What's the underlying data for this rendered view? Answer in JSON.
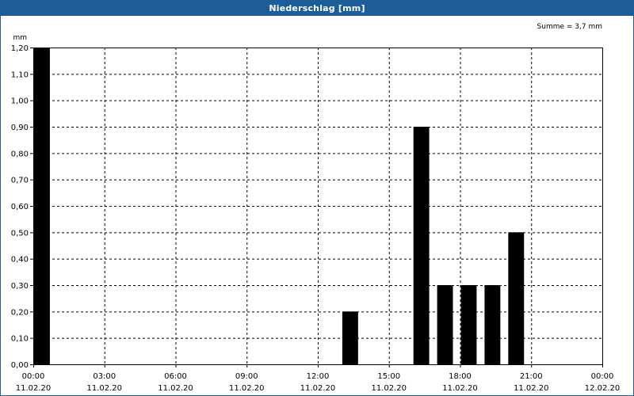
{
  "window": {
    "title": "Niederschlag [mm]"
  },
  "chart_data": {
    "type": "bar",
    "title": "Niederschlag [mm]",
    "unit_label": "mm",
    "annotation": "Summe = 3,7 mm",
    "ylim": [
      0,
      1.2
    ],
    "yticks": [
      "0,00",
      "0,10",
      "0,20",
      "0,30",
      "0,40",
      "0,50",
      "0,60",
      "0,70",
      "0,80",
      "0,90",
      "1,00",
      "1,10",
      "1,20"
    ],
    "xlim_hours": [
      0,
      24
    ],
    "xticks": [
      {
        "time": "00:00",
        "date": "11.02.20"
      },
      {
        "time": "03:00",
        "date": "11.02.20"
      },
      {
        "time": "06:00",
        "date": "11.02.20"
      },
      {
        "time": "09:00",
        "date": "11.02.20"
      },
      {
        "time": "12:00",
        "date": "11.02.20"
      },
      {
        "time": "15:00",
        "date": "11.02.20"
      },
      {
        "time": "18:00",
        "date": "11.02.20"
      },
      {
        "time": "21:00",
        "date": "11.02.20"
      },
      {
        "time": "00:00",
        "date": "12.02.20"
      }
    ],
    "bars": [
      {
        "hour": 0,
        "value": 1.2
      },
      {
        "hour": 13,
        "value": 0.2
      },
      {
        "hour": 16,
        "value": 0.9
      },
      {
        "hour": 17,
        "value": 0.3
      },
      {
        "hour": 18,
        "value": 0.3
      },
      {
        "hour": 19,
        "value": 0.3
      },
      {
        "hour": 20,
        "value": 0.5
      }
    ],
    "grid": true,
    "colors": {
      "bar": "#000000",
      "titlebar": "#1c5d99",
      "grid": "#000000"
    }
  }
}
